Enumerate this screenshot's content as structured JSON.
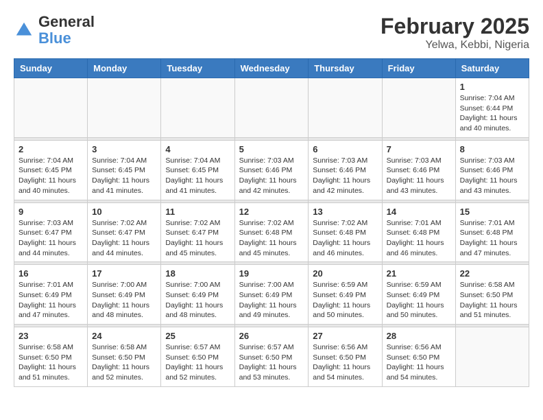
{
  "logo": {
    "text_general": "General",
    "text_blue": "Blue"
  },
  "title": "February 2025",
  "subtitle": "Yelwa, Kebbi, Nigeria",
  "days_of_week": [
    "Sunday",
    "Monday",
    "Tuesday",
    "Wednesday",
    "Thursday",
    "Friday",
    "Saturday"
  ],
  "weeks": [
    [
      {
        "day": "",
        "info": ""
      },
      {
        "day": "",
        "info": ""
      },
      {
        "day": "",
        "info": ""
      },
      {
        "day": "",
        "info": ""
      },
      {
        "day": "",
        "info": ""
      },
      {
        "day": "",
        "info": ""
      },
      {
        "day": "1",
        "info": "Sunrise: 7:04 AM\nSunset: 6:44 PM\nDaylight: 11 hours\nand 40 minutes."
      }
    ],
    [
      {
        "day": "2",
        "info": "Sunrise: 7:04 AM\nSunset: 6:45 PM\nDaylight: 11 hours\nand 40 minutes."
      },
      {
        "day": "3",
        "info": "Sunrise: 7:04 AM\nSunset: 6:45 PM\nDaylight: 11 hours\nand 41 minutes."
      },
      {
        "day": "4",
        "info": "Sunrise: 7:04 AM\nSunset: 6:45 PM\nDaylight: 11 hours\nand 41 minutes."
      },
      {
        "day": "5",
        "info": "Sunrise: 7:03 AM\nSunset: 6:46 PM\nDaylight: 11 hours\nand 42 minutes."
      },
      {
        "day": "6",
        "info": "Sunrise: 7:03 AM\nSunset: 6:46 PM\nDaylight: 11 hours\nand 42 minutes."
      },
      {
        "day": "7",
        "info": "Sunrise: 7:03 AM\nSunset: 6:46 PM\nDaylight: 11 hours\nand 43 minutes."
      },
      {
        "day": "8",
        "info": "Sunrise: 7:03 AM\nSunset: 6:46 PM\nDaylight: 11 hours\nand 43 minutes."
      }
    ],
    [
      {
        "day": "9",
        "info": "Sunrise: 7:03 AM\nSunset: 6:47 PM\nDaylight: 11 hours\nand 44 minutes."
      },
      {
        "day": "10",
        "info": "Sunrise: 7:02 AM\nSunset: 6:47 PM\nDaylight: 11 hours\nand 44 minutes."
      },
      {
        "day": "11",
        "info": "Sunrise: 7:02 AM\nSunset: 6:47 PM\nDaylight: 11 hours\nand 45 minutes."
      },
      {
        "day": "12",
        "info": "Sunrise: 7:02 AM\nSunset: 6:48 PM\nDaylight: 11 hours\nand 45 minutes."
      },
      {
        "day": "13",
        "info": "Sunrise: 7:02 AM\nSunset: 6:48 PM\nDaylight: 11 hours\nand 46 minutes."
      },
      {
        "day": "14",
        "info": "Sunrise: 7:01 AM\nSunset: 6:48 PM\nDaylight: 11 hours\nand 46 minutes."
      },
      {
        "day": "15",
        "info": "Sunrise: 7:01 AM\nSunset: 6:48 PM\nDaylight: 11 hours\nand 47 minutes."
      }
    ],
    [
      {
        "day": "16",
        "info": "Sunrise: 7:01 AM\nSunset: 6:49 PM\nDaylight: 11 hours\nand 47 minutes."
      },
      {
        "day": "17",
        "info": "Sunrise: 7:00 AM\nSunset: 6:49 PM\nDaylight: 11 hours\nand 48 minutes."
      },
      {
        "day": "18",
        "info": "Sunrise: 7:00 AM\nSunset: 6:49 PM\nDaylight: 11 hours\nand 48 minutes."
      },
      {
        "day": "19",
        "info": "Sunrise: 7:00 AM\nSunset: 6:49 PM\nDaylight: 11 hours\nand 49 minutes."
      },
      {
        "day": "20",
        "info": "Sunrise: 6:59 AM\nSunset: 6:49 PM\nDaylight: 11 hours\nand 50 minutes."
      },
      {
        "day": "21",
        "info": "Sunrise: 6:59 AM\nSunset: 6:49 PM\nDaylight: 11 hours\nand 50 minutes."
      },
      {
        "day": "22",
        "info": "Sunrise: 6:58 AM\nSunset: 6:50 PM\nDaylight: 11 hours\nand 51 minutes."
      }
    ],
    [
      {
        "day": "23",
        "info": "Sunrise: 6:58 AM\nSunset: 6:50 PM\nDaylight: 11 hours\nand 51 minutes."
      },
      {
        "day": "24",
        "info": "Sunrise: 6:58 AM\nSunset: 6:50 PM\nDaylight: 11 hours\nand 52 minutes."
      },
      {
        "day": "25",
        "info": "Sunrise: 6:57 AM\nSunset: 6:50 PM\nDaylight: 11 hours\nand 52 minutes."
      },
      {
        "day": "26",
        "info": "Sunrise: 6:57 AM\nSunset: 6:50 PM\nDaylight: 11 hours\nand 53 minutes."
      },
      {
        "day": "27",
        "info": "Sunrise: 6:56 AM\nSunset: 6:50 PM\nDaylight: 11 hours\nand 54 minutes."
      },
      {
        "day": "28",
        "info": "Sunrise: 6:56 AM\nSunset: 6:50 PM\nDaylight: 11 hours\nand 54 minutes."
      },
      {
        "day": "",
        "info": ""
      }
    ]
  ]
}
